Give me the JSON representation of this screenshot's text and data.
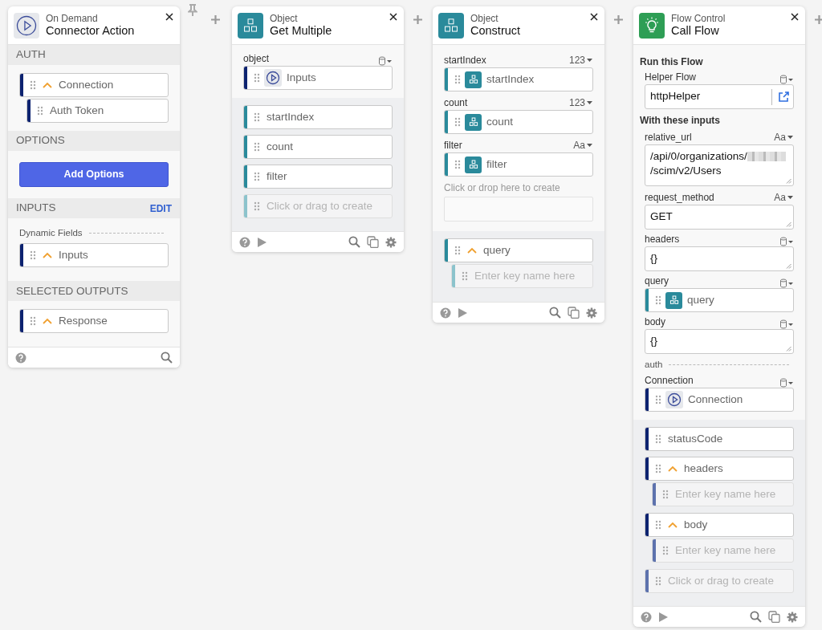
{
  "cards": [
    {
      "kind": "connector",
      "category": "On Demand",
      "title": "Connector Action",
      "pinned": true,
      "regions": [
        {
          "kind": "header",
          "label": "AUTH"
        },
        {
          "kind": "light",
          "items": [
            {
              "kind": "pill",
              "text": "Connection",
              "color": "#0d2370",
              "expanded": true,
              "children": [
                {
                  "kind": "pill",
                  "text": "Auth Token",
                  "color": "#0d2370"
                }
              ]
            }
          ]
        },
        {
          "kind": "header",
          "label": "OPTIONS"
        },
        {
          "kind": "light",
          "items": [
            {
              "kind": "button",
              "text": "Add Options"
            }
          ]
        },
        {
          "kind": "header",
          "label": "INPUTS",
          "action": "EDIT"
        },
        {
          "kind": "light",
          "items": [
            {
              "kind": "divider",
              "text": "Dynamic Fields"
            },
            {
              "kind": "pill",
              "text": "Inputs",
              "color": "#0d2370",
              "expanded": true
            }
          ]
        },
        {
          "kind": "header",
          "label": "SELECTED OUTPUTS"
        },
        {
          "kind": "light",
          "items": [
            {
              "kind": "pill",
              "text": "Response",
              "color": "#0d2370",
              "expanded": true
            }
          ]
        }
      ]
    },
    {
      "kind": "object",
      "category": "Object",
      "title": "Get Multiple",
      "pinned": false,
      "regions": [
        {
          "kind": "light",
          "items": [
            {
              "kind": "field",
              "label": "object",
              "type": {
                "kind": "database"
              },
              "control": {
                "kind": "connector_pill",
                "text": "Inputs",
                "color": "#0d2370"
              }
            }
          ]
        },
        {
          "kind": "grey",
          "items": [
            {
              "kind": "pill",
              "text": "startIndex",
              "color": "#2a8a9b"
            },
            {
              "kind": "pill",
              "text": "count",
              "color": "#2a8a9b"
            },
            {
              "kind": "pill",
              "text": "filter",
              "color": "#2a8a9b"
            },
            {
              "kind": "pill",
              "placeholder": "Click or drag to create",
              "color": "#8cc3cc"
            }
          ]
        }
      ]
    },
    {
      "kind": "object",
      "category": "Object",
      "title": "Construct",
      "pinned": false,
      "regions": [
        {
          "kind": "light",
          "items": [
            {
              "kind": "field",
              "label": "startIndex",
              "type": {
                "kind": "text",
                "label": "123"
              },
              "control": {
                "kind": "object_pill",
                "text": "startIndex",
                "color": "#2a8a9b"
              }
            },
            {
              "kind": "field",
              "label": "count",
              "type": {
                "kind": "text",
                "label": "123"
              },
              "control": {
                "kind": "object_pill",
                "text": "count",
                "color": "#2a8a9b"
              }
            },
            {
              "kind": "field",
              "label": "filter",
              "type": {
                "kind": "text",
                "label": "Aa"
              },
              "control": {
                "kind": "object_pill",
                "text": "filter",
                "color": "#2a8a9b"
              }
            },
            {
              "kind": "dropzone",
              "text": "Click or drop here to create"
            }
          ]
        },
        {
          "kind": "grey",
          "items": [
            {
              "kind": "pill",
              "text": "query",
              "color": "#2a8a9b",
              "expanded": true,
              "children": [
                {
                  "kind": "pill",
                  "placeholder": "Enter key name here",
                  "color": "#8cc3cc"
                }
              ]
            }
          ]
        }
      ]
    },
    {
      "kind": "flow",
      "category": "Flow Control",
      "title": "Call Flow",
      "pinned": false,
      "regions": [
        {
          "kind": "light",
          "items": [
            {
              "kind": "heading",
              "text": "Run this Flow"
            },
            {
              "kind": "field",
              "label": "Helper Flow",
              "type": {
                "kind": "database"
              },
              "control": {
                "kind": "linked_input",
                "value": "httpHelper"
              }
            },
            {
              "kind": "heading",
              "text": "With these inputs"
            },
            {
              "kind": "field",
              "label": "relative_url",
              "type": {
                "kind": "text",
                "label": "Aa"
              },
              "control": {
                "kind": "textarea",
                "value": "/api/0/organizations/",
                "redacted": true,
                "value_end": "/scim/v2/Users"
              }
            },
            {
              "kind": "field",
              "label": "request_method",
              "type": {
                "kind": "text",
                "label": "Aa"
              },
              "control": {
                "kind": "textarea",
                "value": "GET"
              }
            },
            {
              "kind": "field",
              "label": "headers",
              "type": {
                "kind": "database"
              },
              "control": {
                "kind": "textarea",
                "value": "{}"
              }
            },
            {
              "kind": "field",
              "label": "query",
              "type": {
                "kind": "database"
              },
              "control": {
                "kind": "object_pill",
                "text": "query",
                "color": "#2a8a9b"
              }
            },
            {
              "kind": "field",
              "label": "body",
              "type": {
                "kind": "database"
              },
              "control": {
                "kind": "textarea",
                "value": "{}"
              }
            },
            {
              "kind": "divider",
              "text": "auth"
            },
            {
              "kind": "field",
              "label": "Connection",
              "type": {
                "kind": "database"
              },
              "control": {
                "kind": "connector_pill",
                "text": "Connection",
                "color": "#0d2370"
              }
            }
          ]
        },
        {
          "kind": "grey",
          "items": [
            {
              "kind": "pill",
              "text": "statusCode",
              "color": "#0d2370"
            },
            {
              "kind": "pill",
              "text": "headers",
              "color": "#0d2370",
              "expanded": true,
              "children": [
                {
                  "kind": "pill",
                  "placeholder": "Enter key name here",
                  "color": "#5d72ad"
                }
              ]
            },
            {
              "kind": "pill",
              "text": "body",
              "color": "#0d2370",
              "expanded": true,
              "children": [
                {
                  "kind": "pill",
                  "placeholder": "Enter key name here",
                  "color": "#5d72ad"
                }
              ]
            },
            {
              "kind": "pill",
              "placeholder": "Click or drag to create",
              "color": "#5d72ad"
            }
          ]
        }
      ]
    }
  ]
}
